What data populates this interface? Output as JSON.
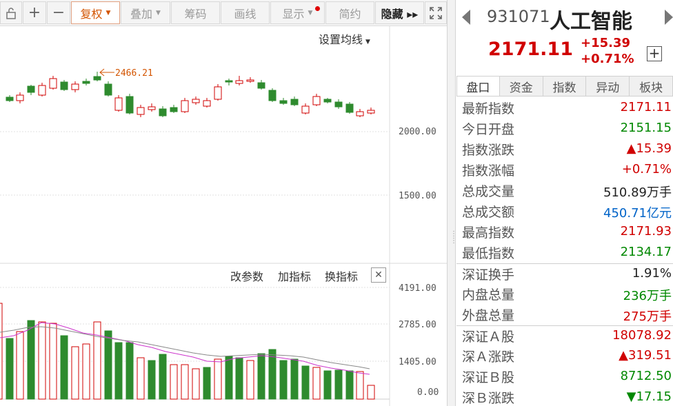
{
  "toolbar": {
    "buttons": [
      "复权",
      "叠加",
      "筹码",
      "画线",
      "显示",
      "简约",
      "隐藏 ▸▸"
    ]
  },
  "chart": {
    "ma_setting": "设置均线",
    "high_marker": "2466.21",
    "price_axis": [
      "2000.00",
      "1500.00"
    ],
    "indicator_links": [
      "改参数",
      "加指标",
      "换指标"
    ],
    "close_glyph": "✕",
    "volume_axis": [
      "4191.00",
      "2785.00",
      "1405.00",
      "0.00"
    ],
    "colors": {
      "up": "#d00000",
      "down": "#2e8b2e",
      "ma_pink": "#cc33cc",
      "ma_gray": "#888888"
    }
  },
  "chart_data": {
    "type": "candlestick",
    "price_levels": [
      2000,
      1500
    ],
    "high_marker_value": 2466.21,
    "volume_levels": [
      4191,
      2785,
      1405,
      0
    ]
  },
  "header": {
    "code": "931071",
    "name": "人工智能",
    "price": "2171.11",
    "change": "+15.39",
    "change_pct": "+0.71%",
    "add_glyph": "+"
  },
  "tabs": [
    "盘口",
    "资金",
    "指数",
    "异动",
    "板块"
  ],
  "stats": [
    {
      "label": "最新指数",
      "value": "2171.11",
      "color": "red"
    },
    {
      "label": "今日开盘",
      "value": "2151.15",
      "color": "green"
    },
    {
      "label": "指数涨跌",
      "value": "▲15.39",
      "color": "red"
    },
    {
      "label": "指数涨幅",
      "value": "+0.71%",
      "color": "red"
    },
    {
      "label": "总成交量",
      "value": "510.89万手",
      "color": "dark"
    },
    {
      "label": "总成交额",
      "value": "450.71亿元",
      "color": "blue"
    },
    {
      "label": "最高指数",
      "value": "2171.93",
      "color": "red"
    },
    {
      "label": "最低指数",
      "value": "2134.17",
      "color": "green"
    },
    {
      "label": "深证换手",
      "value": "1.91%",
      "color": "dark",
      "sep": true
    },
    {
      "label": "内盘总量",
      "value": "236万手",
      "color": "green"
    },
    {
      "label": "外盘总量",
      "value": "275万手",
      "color": "red"
    },
    {
      "label": "深证Ａ股",
      "value": "18078.92",
      "color": "red",
      "sep": true
    },
    {
      "label": "深Ａ涨跌",
      "value": "▲319.51",
      "color": "red"
    },
    {
      "label": "深证Ｂ股",
      "value": "8712.50",
      "color": "green"
    },
    {
      "label": "深Ｂ涨跌",
      "value": "▼17.15",
      "color": "green"
    }
  ]
}
